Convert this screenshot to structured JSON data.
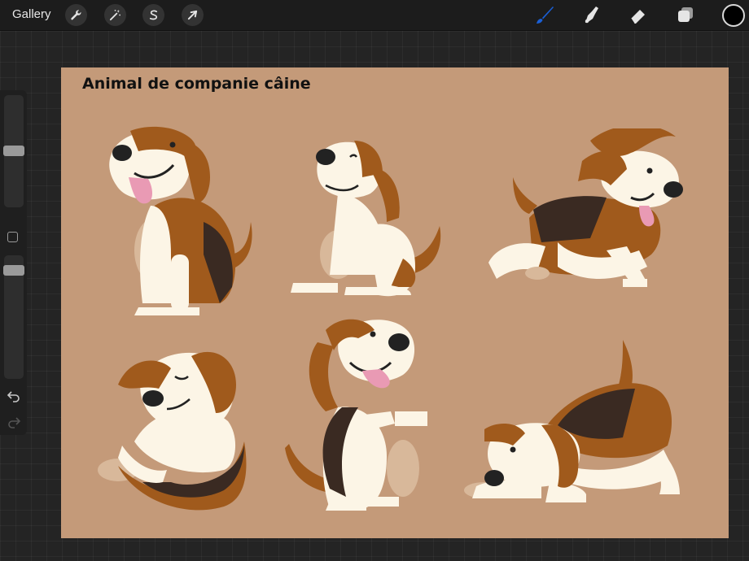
{
  "toolbar": {
    "gallery_label": "Gallery",
    "left_tools": [
      "wrench-icon",
      "magic-wand-icon",
      "selection-s-icon",
      "arrow-cursor-icon"
    ],
    "right_tools": [
      "brush-icon",
      "smudge-icon",
      "eraser-icon",
      "layers-icon"
    ],
    "active_tool": "brush-icon",
    "active_color": "#1a5fd6",
    "current_color": "#000000"
  },
  "sidebar": {
    "brush_size_label": "",
    "opacity_label": "",
    "undo_icon": "undo-icon",
    "redo_icon": "redo-icon"
  },
  "canvas": {
    "title": "Animal de companie câine",
    "background": "#c49a79",
    "illustrations": [
      "beagle-sitting-tongue-out",
      "beagle-scratching-ear",
      "beagle-running",
      "beagle-lying-on-back",
      "beagle-begging",
      "beagle-play-bow"
    ]
  }
}
